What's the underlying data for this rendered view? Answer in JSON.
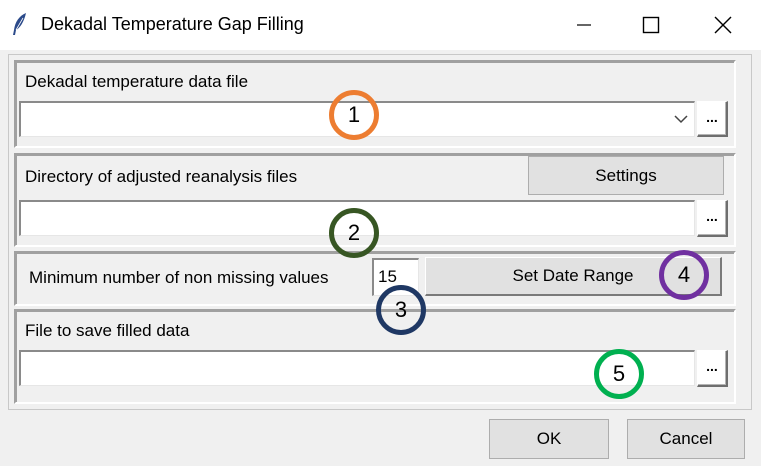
{
  "window": {
    "title": "Dekadal Temperature Gap Filling",
    "icon": "feather-icon"
  },
  "section_data_file": {
    "label": "Dekadal temperature data file",
    "value": "",
    "browse_label": "..."
  },
  "section_reanalysis": {
    "label": "Directory of adjusted reanalysis files",
    "settings_label": "Settings",
    "value": "",
    "browse_label": "..."
  },
  "section_min_values": {
    "label": "Minimum number of non missing values",
    "value": "15",
    "date_range_label": "Set Date Range"
  },
  "section_save": {
    "label": "File to save filled data",
    "value": "",
    "browse_label": "..."
  },
  "footer": {
    "ok_label": "OK",
    "cancel_label": "Cancel"
  },
  "annotations": [
    {
      "number": "1",
      "color": "#ed7d31"
    },
    {
      "number": "2",
      "color": "#375623"
    },
    {
      "number": "3",
      "color": "#1f3864"
    },
    {
      "number": "4",
      "color": "#7030a0"
    },
    {
      "number": "5",
      "color": "#00b050"
    }
  ]
}
